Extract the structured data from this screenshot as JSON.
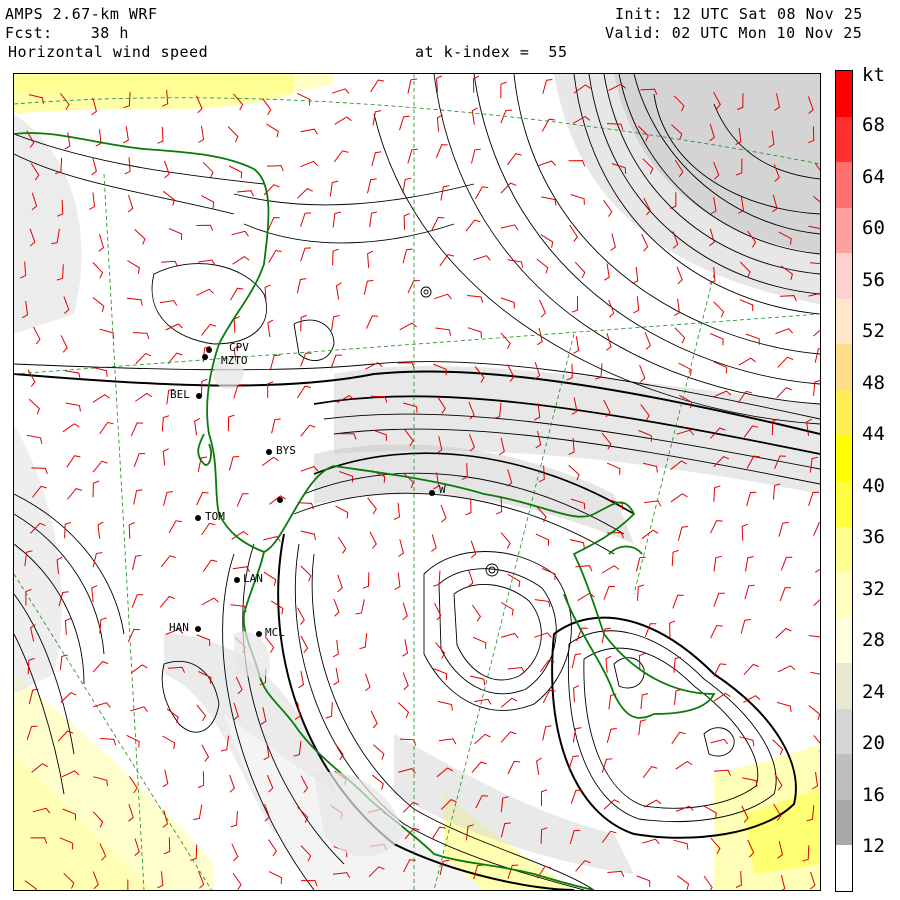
{
  "header": {
    "model": "AMPS 2.67-km WRF",
    "forecast": "Fcst:    38 h",
    "field": "Horizontal wind speed",
    "level": "at k-index =  55",
    "init": "Init: 12 UTC Sat 08 Nov 25",
    "valid": "Valid: 02 UTC Mon 10 Nov 25"
  },
  "colorbar": {
    "unit": "kt",
    "tick_labels": [
      "68",
      "64",
      "60",
      "56",
      "52",
      "48",
      "44",
      "40",
      "36",
      "32",
      "28",
      "24",
      "20",
      "16",
      "12"
    ],
    "colors": [
      "#ff0000",
      "#ff3030",
      "#ff7070",
      "#ffa0a0",
      "#ffd0d0",
      "#ffe8c8",
      "#ffdd88",
      "#ffee55",
      "#ffff00",
      "#ffff40",
      "#ffff90",
      "#ffffc0",
      "#ffffe0",
      "#e8e8d0",
      "#d6d6d6",
      "#bebebe",
      "#a8a8a8",
      "#ffffff"
    ]
  },
  "stations": [
    {
      "code": "CPV"
    },
    {
      "code": "MZTO"
    },
    {
      "code": "BEL"
    },
    {
      "code": "BYS"
    },
    {
      "code": "TOM"
    },
    {
      "code": "LAN"
    },
    {
      "code": "HAN"
    },
    {
      "code": "MCL"
    },
    {
      "code": "W"
    }
  ]
}
